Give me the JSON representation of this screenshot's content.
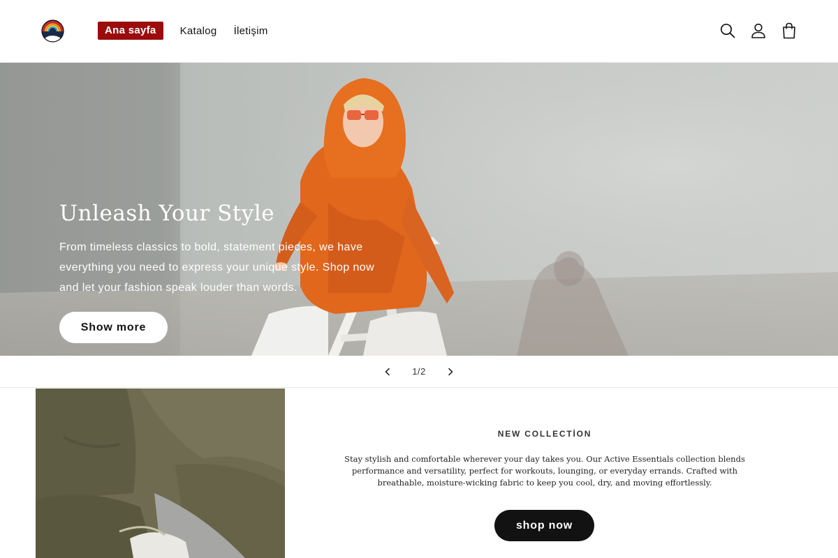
{
  "header": {
    "logo_icon": "rainbow-logo-icon",
    "nav": [
      {
        "label": "Ana sayfa",
        "active": true
      },
      {
        "label": "Katalog",
        "active": false
      },
      {
        "label": "İletişim",
        "active": false
      }
    ],
    "icons": [
      "search-icon",
      "account-icon",
      "cart-icon"
    ]
  },
  "hero": {
    "title": "Unleash Your Style",
    "text": "From timeless classics to bold, statement pieces, we have everything you need to express your unique style. Shop now and let your fashion speak louder than words.",
    "button_label": "Show more"
  },
  "slider": {
    "counter": "1/2",
    "prev_icon": "chevron-left-icon",
    "next_icon": "chevron-right-icon"
  },
  "collection": {
    "heading": "NEW COLLECTİON",
    "text": "Stay stylish and comfortable wherever your day takes you. Our Active Essentials collection blends performance and versatility, perfect for workouts, lounging, or everyday errands. Crafted with breathable, moisture-wicking fabric to keep you cool, dry, and moving effortlessly.",
    "button_label": "shop now"
  },
  "colors": {
    "accent": "#9b0c0c",
    "dark_button": "#121212",
    "hero_orange": "#e0671c"
  }
}
